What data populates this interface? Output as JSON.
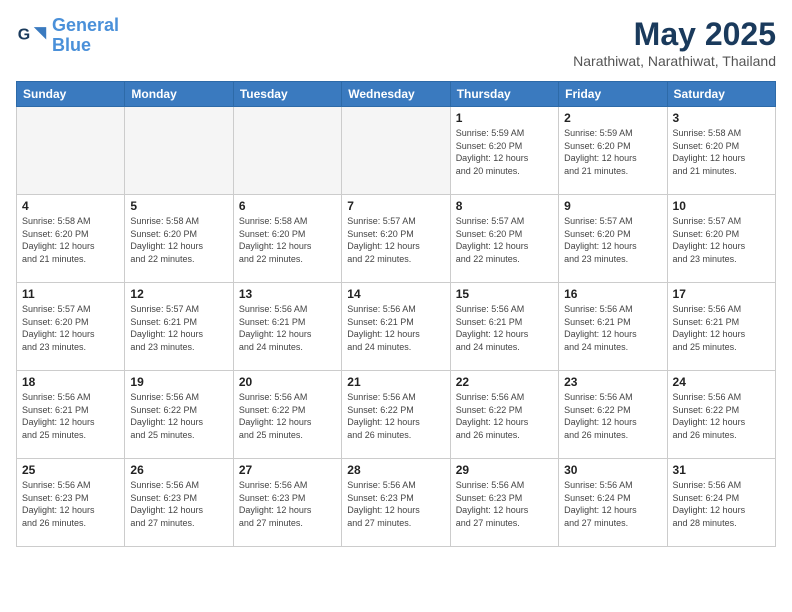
{
  "header": {
    "logo_line1": "General",
    "logo_line2": "Blue",
    "main_title": "May 2025",
    "subtitle": "Narathiwat, Narathiwat, Thailand"
  },
  "weekdays": [
    "Sunday",
    "Monday",
    "Tuesday",
    "Wednesday",
    "Thursday",
    "Friday",
    "Saturday"
  ],
  "weeks": [
    [
      {
        "day": "",
        "info": ""
      },
      {
        "day": "",
        "info": ""
      },
      {
        "day": "",
        "info": ""
      },
      {
        "day": "",
        "info": ""
      },
      {
        "day": "1",
        "info": "Sunrise: 5:59 AM\nSunset: 6:20 PM\nDaylight: 12 hours\nand 20 minutes."
      },
      {
        "day": "2",
        "info": "Sunrise: 5:59 AM\nSunset: 6:20 PM\nDaylight: 12 hours\nand 21 minutes."
      },
      {
        "day": "3",
        "info": "Sunrise: 5:58 AM\nSunset: 6:20 PM\nDaylight: 12 hours\nand 21 minutes."
      }
    ],
    [
      {
        "day": "4",
        "info": "Sunrise: 5:58 AM\nSunset: 6:20 PM\nDaylight: 12 hours\nand 21 minutes."
      },
      {
        "day": "5",
        "info": "Sunrise: 5:58 AM\nSunset: 6:20 PM\nDaylight: 12 hours\nand 22 minutes."
      },
      {
        "day": "6",
        "info": "Sunrise: 5:58 AM\nSunset: 6:20 PM\nDaylight: 12 hours\nand 22 minutes."
      },
      {
        "day": "7",
        "info": "Sunrise: 5:57 AM\nSunset: 6:20 PM\nDaylight: 12 hours\nand 22 minutes."
      },
      {
        "day": "8",
        "info": "Sunrise: 5:57 AM\nSunset: 6:20 PM\nDaylight: 12 hours\nand 22 minutes."
      },
      {
        "day": "9",
        "info": "Sunrise: 5:57 AM\nSunset: 6:20 PM\nDaylight: 12 hours\nand 23 minutes."
      },
      {
        "day": "10",
        "info": "Sunrise: 5:57 AM\nSunset: 6:20 PM\nDaylight: 12 hours\nand 23 minutes."
      }
    ],
    [
      {
        "day": "11",
        "info": "Sunrise: 5:57 AM\nSunset: 6:20 PM\nDaylight: 12 hours\nand 23 minutes."
      },
      {
        "day": "12",
        "info": "Sunrise: 5:57 AM\nSunset: 6:21 PM\nDaylight: 12 hours\nand 23 minutes."
      },
      {
        "day": "13",
        "info": "Sunrise: 5:56 AM\nSunset: 6:21 PM\nDaylight: 12 hours\nand 24 minutes."
      },
      {
        "day": "14",
        "info": "Sunrise: 5:56 AM\nSunset: 6:21 PM\nDaylight: 12 hours\nand 24 minutes."
      },
      {
        "day": "15",
        "info": "Sunrise: 5:56 AM\nSunset: 6:21 PM\nDaylight: 12 hours\nand 24 minutes."
      },
      {
        "day": "16",
        "info": "Sunrise: 5:56 AM\nSunset: 6:21 PM\nDaylight: 12 hours\nand 24 minutes."
      },
      {
        "day": "17",
        "info": "Sunrise: 5:56 AM\nSunset: 6:21 PM\nDaylight: 12 hours\nand 25 minutes."
      }
    ],
    [
      {
        "day": "18",
        "info": "Sunrise: 5:56 AM\nSunset: 6:21 PM\nDaylight: 12 hours\nand 25 minutes."
      },
      {
        "day": "19",
        "info": "Sunrise: 5:56 AM\nSunset: 6:22 PM\nDaylight: 12 hours\nand 25 minutes."
      },
      {
        "day": "20",
        "info": "Sunrise: 5:56 AM\nSunset: 6:22 PM\nDaylight: 12 hours\nand 25 minutes."
      },
      {
        "day": "21",
        "info": "Sunrise: 5:56 AM\nSunset: 6:22 PM\nDaylight: 12 hours\nand 26 minutes."
      },
      {
        "day": "22",
        "info": "Sunrise: 5:56 AM\nSunset: 6:22 PM\nDaylight: 12 hours\nand 26 minutes."
      },
      {
        "day": "23",
        "info": "Sunrise: 5:56 AM\nSunset: 6:22 PM\nDaylight: 12 hours\nand 26 minutes."
      },
      {
        "day": "24",
        "info": "Sunrise: 5:56 AM\nSunset: 6:22 PM\nDaylight: 12 hours\nand 26 minutes."
      }
    ],
    [
      {
        "day": "25",
        "info": "Sunrise: 5:56 AM\nSunset: 6:23 PM\nDaylight: 12 hours\nand 26 minutes."
      },
      {
        "day": "26",
        "info": "Sunrise: 5:56 AM\nSunset: 6:23 PM\nDaylight: 12 hours\nand 27 minutes."
      },
      {
        "day": "27",
        "info": "Sunrise: 5:56 AM\nSunset: 6:23 PM\nDaylight: 12 hours\nand 27 minutes."
      },
      {
        "day": "28",
        "info": "Sunrise: 5:56 AM\nSunset: 6:23 PM\nDaylight: 12 hours\nand 27 minutes."
      },
      {
        "day": "29",
        "info": "Sunrise: 5:56 AM\nSunset: 6:23 PM\nDaylight: 12 hours\nand 27 minutes."
      },
      {
        "day": "30",
        "info": "Sunrise: 5:56 AM\nSunset: 6:24 PM\nDaylight: 12 hours\nand 27 minutes."
      },
      {
        "day": "31",
        "info": "Sunrise: 5:56 AM\nSunset: 6:24 PM\nDaylight: 12 hours\nand 28 minutes."
      }
    ]
  ]
}
